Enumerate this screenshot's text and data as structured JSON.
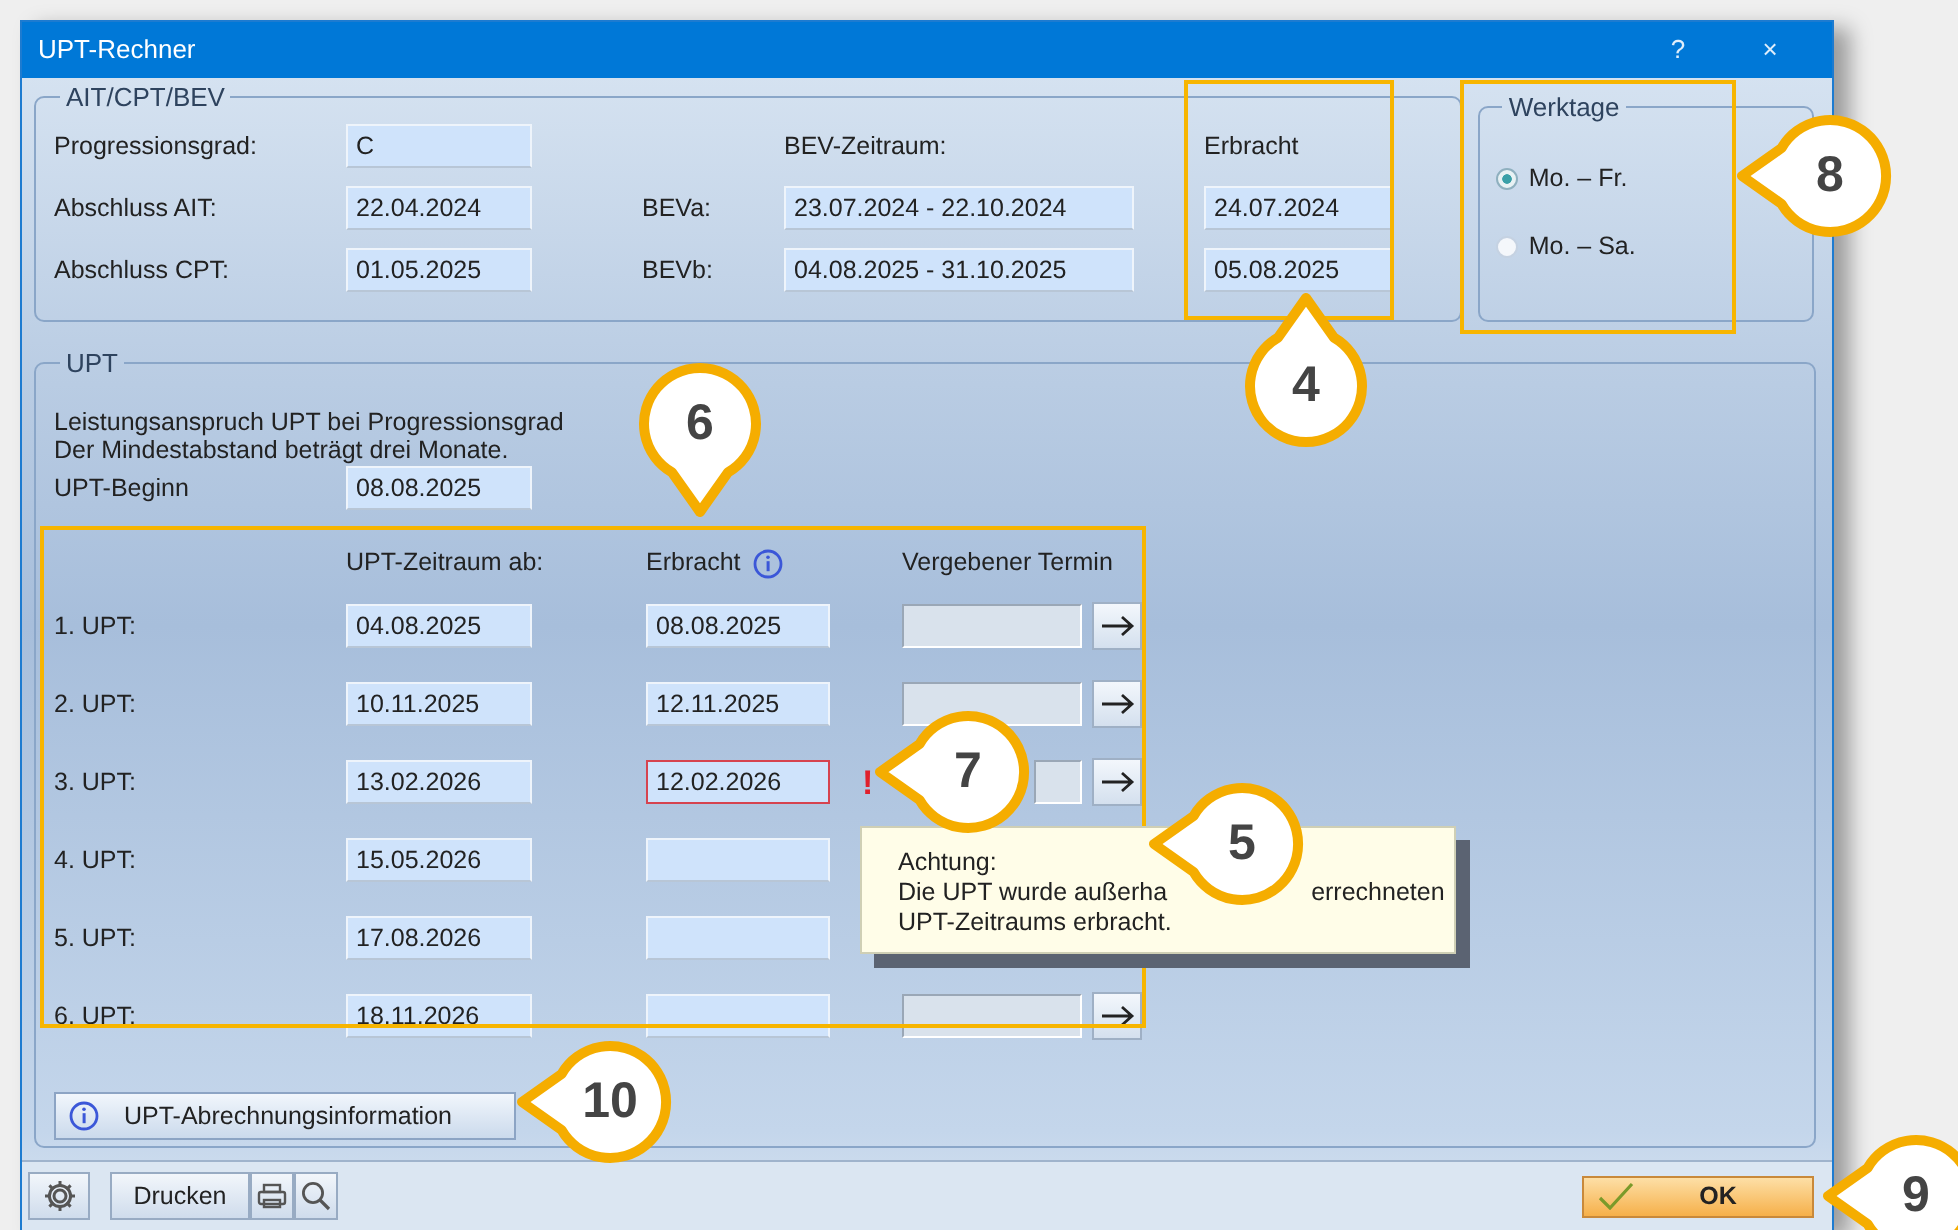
{
  "window": {
    "title": "UPT-Rechner",
    "buttons": [
      "?",
      "×"
    ]
  },
  "ait_cpt_bev": {
    "legend": "AIT/CPT/BEV",
    "bev_header": "BEV-Zeitraum:",
    "erbracht_header": "Erbracht",
    "progressionsgrad": {
      "label": "Progressionsgrad:",
      "value": "C"
    },
    "rows": [
      {
        "label": "Abschluss AIT:",
        "value": "22.04.2024",
        "bev_label": "BEVa:",
        "bev_value": "23.07.2024 - 22.10.2024",
        "erbracht": "24.07.2024"
      },
      {
        "label": "Abschluss CPT:",
        "value": "01.05.2025",
        "bev_label": "BEVb:",
        "bev_value": "04.08.2025 - 31.10.2025",
        "erbracht": "05.08.2025"
      }
    ]
  },
  "werktage": {
    "legend": "Werktage",
    "options": [
      {
        "label": "Mo. – Fr.",
        "selected": true
      },
      {
        "label": "Mo. – Sa.",
        "selected": false
      }
    ]
  },
  "upt": {
    "legend": "UPT",
    "info_lines": [
      "Leistungsanspruch UPT bei Progressionsgrad",
      "Der Mindestabstand beträgt drei Monate."
    ],
    "beginn": {
      "label": "UPT-Beginn",
      "value": "08.08.2025"
    },
    "columns": [
      "UPT-Zeitraum ab:",
      "Erbracht",
      "Vergebener Termin"
    ],
    "rows": [
      {
        "label": "1. UPT:",
        "from": "04.08.2025",
        "erbracht": "08.08.2025",
        "invalid": false,
        "termin_visible": true
      },
      {
        "label": "2. UPT:",
        "from": "10.11.2025",
        "erbracht": "12.11.2025",
        "invalid": false,
        "termin_visible": true
      },
      {
        "label": "3. UPT:",
        "from": "13.02.2026",
        "erbracht": "12.02.2026",
        "invalid": true,
        "flag": "!",
        "termin_visible": true
      },
      {
        "label": "4. UPT:",
        "from": "15.05.2026",
        "invalid": false,
        "termin_visible": false
      },
      {
        "label": "5. UPT:",
        "from": "17.08.2026",
        "invalid": false,
        "termin_visible": false
      },
      {
        "label": "6. UPT:",
        "from": "18.11.2026",
        "invalid": false,
        "termin_visible": true
      }
    ],
    "info_button": "UPT-Abrechnungsinformation"
  },
  "tooltip": {
    "lines": [
      [
        "Achtung:"
      ],
      [
        "Die UPT wurde außerha",
        "errechneten"
      ],
      [
        "UPT-Zeitraums erbracht."
      ]
    ]
  },
  "footer": {
    "print_button": "Drucken",
    "ok_button": "OK"
  },
  "callouts": [
    {
      "number": "8"
    },
    {
      "number": "4"
    },
    {
      "number": "6"
    },
    {
      "number": "7"
    },
    {
      "number": "5"
    },
    {
      "number": "10"
    },
    {
      "number": "9"
    }
  ]
}
